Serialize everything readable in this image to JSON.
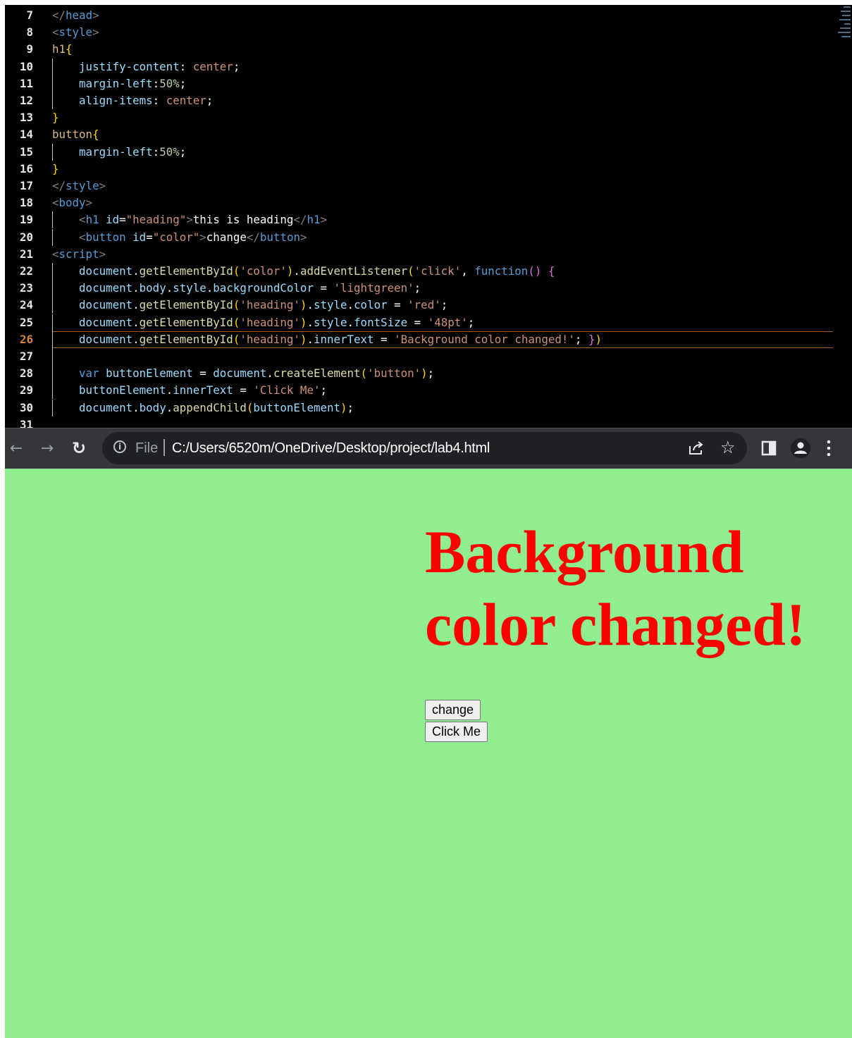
{
  "editor": {
    "active_line": "26",
    "lines": [
      {
        "num": "7",
        "parts": [
          [
            "t-punc",
            "</"
          ],
          [
            "t-tag",
            "head"
          ],
          [
            "t-punc",
            ">"
          ]
        ]
      },
      {
        "num": "8",
        "parts": [
          [
            "t-punc",
            "<"
          ],
          [
            "t-tag",
            "style"
          ],
          [
            "t-punc",
            ">"
          ]
        ]
      },
      {
        "num": "9",
        "parts": [
          [
            "t-sel",
            "h1"
          ],
          [
            "t-b1",
            "{"
          ]
        ]
      },
      {
        "num": "10",
        "indent": true,
        "parts": [
          [
            "t-white",
            "    "
          ],
          [
            "t-prop",
            "justify-content"
          ],
          [
            "t-white",
            ": "
          ],
          [
            "t-val",
            "center"
          ],
          [
            "t-white",
            ";"
          ]
        ]
      },
      {
        "num": "11",
        "indent": true,
        "parts": [
          [
            "t-white",
            "    "
          ],
          [
            "t-prop",
            "margin-left"
          ],
          [
            "t-white",
            ":"
          ],
          [
            "t-num",
            "50%"
          ],
          [
            "t-white",
            ";"
          ]
        ]
      },
      {
        "num": "12",
        "indent": true,
        "parts": [
          [
            "t-white",
            "    "
          ],
          [
            "t-prop",
            "align-items"
          ],
          [
            "t-white",
            ": "
          ],
          [
            "t-val",
            "center"
          ],
          [
            "t-white",
            ";"
          ]
        ]
      },
      {
        "num": "13",
        "parts": [
          [
            "t-b1",
            "}"
          ]
        ]
      },
      {
        "num": "14",
        "parts": [
          [
            "t-sel",
            "button"
          ],
          [
            "t-b1",
            "{"
          ]
        ]
      },
      {
        "num": "15",
        "indent": true,
        "parts": [
          [
            "t-white",
            "    "
          ],
          [
            "t-prop",
            "margin-left"
          ],
          [
            "t-white",
            ":"
          ],
          [
            "t-num",
            "50%"
          ],
          [
            "t-white",
            ";"
          ]
        ]
      },
      {
        "num": "16",
        "parts": [
          [
            "t-b1",
            "}"
          ]
        ]
      },
      {
        "num": "17",
        "parts": [
          [
            "t-punc",
            "</"
          ],
          [
            "t-tag",
            "style"
          ],
          [
            "t-punc",
            ">"
          ]
        ]
      },
      {
        "num": "18",
        "parts": [
          [
            "t-punc",
            "<"
          ],
          [
            "t-tag",
            "body"
          ],
          [
            "t-punc",
            ">"
          ]
        ]
      },
      {
        "num": "19",
        "indent": true,
        "parts": [
          [
            "t-white",
            "    "
          ],
          [
            "t-punc",
            "<"
          ],
          [
            "t-tag",
            "h1"
          ],
          [
            "t-white",
            " "
          ],
          [
            "t-attr",
            "id"
          ],
          [
            "t-white",
            "="
          ],
          [
            "t-str",
            "\"heading\""
          ],
          [
            "t-punc",
            ">"
          ],
          [
            "t-white",
            "this is heading"
          ],
          [
            "t-punc",
            "</"
          ],
          [
            "t-tag",
            "h1"
          ],
          [
            "t-punc",
            ">"
          ]
        ]
      },
      {
        "num": "20",
        "indent": true,
        "parts": [
          [
            "t-white",
            "    "
          ],
          [
            "t-punc",
            "<"
          ],
          [
            "t-tag",
            "button"
          ],
          [
            "t-white",
            " "
          ],
          [
            "t-attr",
            "id"
          ],
          [
            "t-white",
            "="
          ],
          [
            "t-str",
            "\"color\""
          ],
          [
            "t-punc",
            ">"
          ],
          [
            "t-white",
            "change"
          ],
          [
            "t-punc",
            "</"
          ],
          [
            "t-tag",
            "button"
          ],
          [
            "t-punc",
            ">"
          ]
        ]
      },
      {
        "num": "21",
        "parts": [
          [
            "t-punc",
            "<"
          ],
          [
            "t-tag",
            "script"
          ],
          [
            "t-punc",
            ">"
          ]
        ]
      },
      {
        "num": "22",
        "indent": true,
        "parts": [
          [
            "t-white",
            "    "
          ],
          [
            "t-var",
            "document"
          ],
          [
            "t-white",
            "."
          ],
          [
            "t-fn",
            "getElementById"
          ],
          [
            "t-b1",
            "("
          ],
          [
            "t-str",
            "'color'"
          ],
          [
            "t-b1",
            ")"
          ],
          [
            "t-white",
            "."
          ],
          [
            "t-fn",
            "addEventListener"
          ],
          [
            "t-b1",
            "("
          ],
          [
            "t-str",
            "'click'"
          ],
          [
            "t-white",
            ", "
          ],
          [
            "t-kw",
            "function"
          ],
          [
            "t-b2",
            "()"
          ],
          [
            "t-white",
            " "
          ],
          [
            "t-b2",
            "{"
          ]
        ]
      },
      {
        "num": "23",
        "indent": true,
        "parts": [
          [
            "t-white",
            "    "
          ],
          [
            "t-var",
            "document"
          ],
          [
            "t-white",
            "."
          ],
          [
            "t-var",
            "body"
          ],
          [
            "t-white",
            "."
          ],
          [
            "t-var",
            "style"
          ],
          [
            "t-white",
            "."
          ],
          [
            "t-var",
            "backgroundColor"
          ],
          [
            "t-white",
            " = "
          ],
          [
            "t-str",
            "'lightgreen'"
          ],
          [
            "t-white",
            ";"
          ]
        ]
      },
      {
        "num": "24",
        "indent": true,
        "parts": [
          [
            "t-white",
            "    "
          ],
          [
            "t-var",
            "document"
          ],
          [
            "t-white",
            "."
          ],
          [
            "t-fn",
            "getElementById"
          ],
          [
            "t-b1",
            "("
          ],
          [
            "t-str",
            "'heading'"
          ],
          [
            "t-b1",
            ")"
          ],
          [
            "t-white",
            "."
          ],
          [
            "t-var",
            "style"
          ],
          [
            "t-white",
            "."
          ],
          [
            "t-var",
            "color"
          ],
          [
            "t-white",
            " = "
          ],
          [
            "t-str",
            "'red'"
          ],
          [
            "t-white",
            ";"
          ]
        ]
      },
      {
        "num": "25",
        "indent": true,
        "parts": [
          [
            "t-white",
            "    "
          ],
          [
            "t-var",
            "document"
          ],
          [
            "t-white",
            "."
          ],
          [
            "t-fn",
            "getElementById"
          ],
          [
            "t-b1",
            "("
          ],
          [
            "t-str",
            "'heading'"
          ],
          [
            "t-b1",
            ")"
          ],
          [
            "t-white",
            "."
          ],
          [
            "t-var",
            "style"
          ],
          [
            "t-white",
            "."
          ],
          [
            "t-var",
            "fontSize"
          ],
          [
            "t-white",
            " = "
          ],
          [
            "t-str",
            "'48pt'"
          ],
          [
            "t-white",
            ";"
          ]
        ]
      },
      {
        "num": "26",
        "indent": true,
        "parts": [
          [
            "t-white",
            "    "
          ],
          [
            "t-var",
            "document"
          ],
          [
            "t-white",
            "."
          ],
          [
            "t-fn",
            "getElementById"
          ],
          [
            "t-b1",
            "("
          ],
          [
            "t-str",
            "'heading'"
          ],
          [
            "t-b1",
            ")"
          ],
          [
            "t-white",
            "."
          ],
          [
            "t-var",
            "innerText"
          ],
          [
            "t-white",
            " = "
          ],
          [
            "t-str",
            "'Background color changed!'"
          ],
          [
            "t-white",
            "; "
          ],
          [
            "t-b2",
            "}"
          ],
          [
            "t-b1",
            ")"
          ]
        ]
      },
      {
        "num": "27",
        "indent": true,
        "parts": []
      },
      {
        "num": "28",
        "indent": true,
        "parts": [
          [
            "t-white",
            "    "
          ],
          [
            "t-kw",
            "var"
          ],
          [
            "t-white",
            " "
          ],
          [
            "t-var",
            "buttonElement"
          ],
          [
            "t-white",
            " = "
          ],
          [
            "t-var",
            "document"
          ],
          [
            "t-white",
            "."
          ],
          [
            "t-fn",
            "createElement"
          ],
          [
            "t-b1",
            "("
          ],
          [
            "t-str",
            "'button'"
          ],
          [
            "t-b1",
            ")"
          ],
          [
            "t-white",
            ";"
          ]
        ]
      },
      {
        "num": "29",
        "indent": true,
        "parts": [
          [
            "t-white",
            "    "
          ],
          [
            "t-var",
            "buttonElement"
          ],
          [
            "t-white",
            "."
          ],
          [
            "t-var",
            "innerText"
          ],
          [
            "t-white",
            " = "
          ],
          [
            "t-str",
            "'Click Me'"
          ],
          [
            "t-white",
            ";"
          ]
        ]
      },
      {
        "num": "30",
        "indent": true,
        "parts": [
          [
            "t-white",
            "    "
          ],
          [
            "t-var",
            "document"
          ],
          [
            "t-white",
            "."
          ],
          [
            "t-var",
            "body"
          ],
          [
            "t-white",
            "."
          ],
          [
            "t-fn",
            "appendChild"
          ],
          [
            "t-b1",
            "("
          ],
          [
            "t-var",
            "buttonElement"
          ],
          [
            "t-b1",
            ")"
          ],
          [
            "t-white",
            ";"
          ]
        ]
      },
      {
        "num": "31",
        "parts": []
      }
    ]
  },
  "browser": {
    "back_icon": "back-arrow-icon",
    "forward_icon": "forward-arrow-icon",
    "reload_icon": "reload-icon",
    "info_icon": "i",
    "scheme_label": "File",
    "url": "C:/Users/6520m/OneDrive/Desktop/project/lab4.html"
  },
  "page": {
    "background_color": "#90ee90",
    "heading_color": "#ff0000",
    "heading": "Background color changed!",
    "button_change": "change",
    "button_click_me": "Click Me"
  }
}
